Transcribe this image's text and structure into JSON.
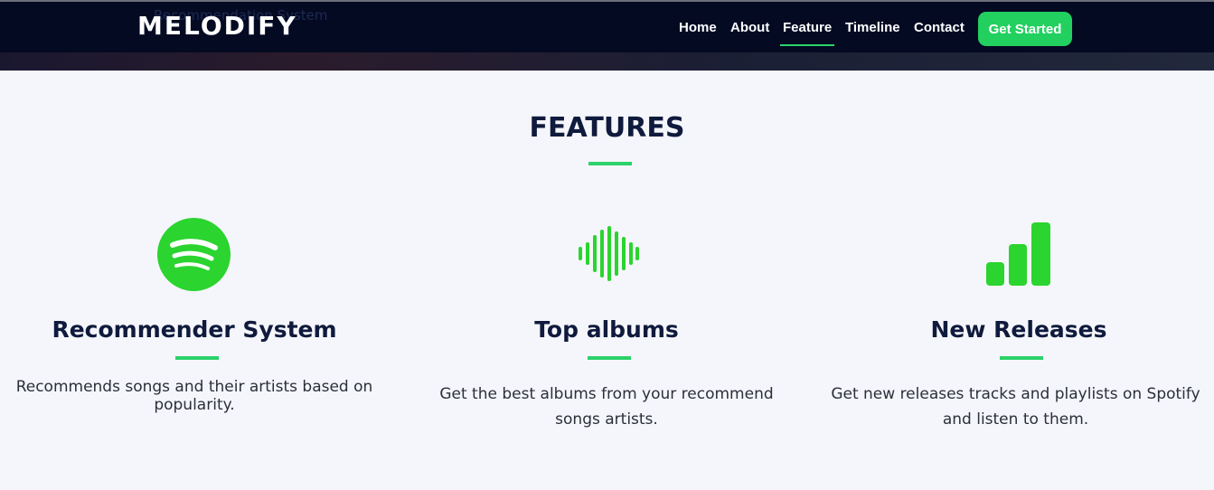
{
  "nav": {
    "logo": "MELODIFY",
    "ghost_text": "Recommendation System",
    "links": [
      "Home",
      "About",
      "Feature",
      "Timeline",
      "Contact"
    ],
    "active_link": "Feature",
    "cta_label": "Get Started"
  },
  "features": {
    "title": "FEATURES",
    "cards": [
      {
        "icon": "spotify-logo-icon",
        "title": "Recommender System",
        "description": "Recommends songs and their artists based on popularity."
      },
      {
        "icon": "sound-wave-icon",
        "title": "Top albums",
        "description": "Get the best albums from your recommend songs artists."
      },
      {
        "icon": "bar-chart-icon",
        "title": "New Releases",
        "description": "Get new releases tracks and playlists on Spotify and listen to them."
      }
    ]
  },
  "colors": {
    "navbar_bg": "#040a22",
    "accent_green": "#2cd26a",
    "icon_green": "#2bd42f",
    "page_bg": "#f5f6fb",
    "heading": "#0f1a3d"
  }
}
